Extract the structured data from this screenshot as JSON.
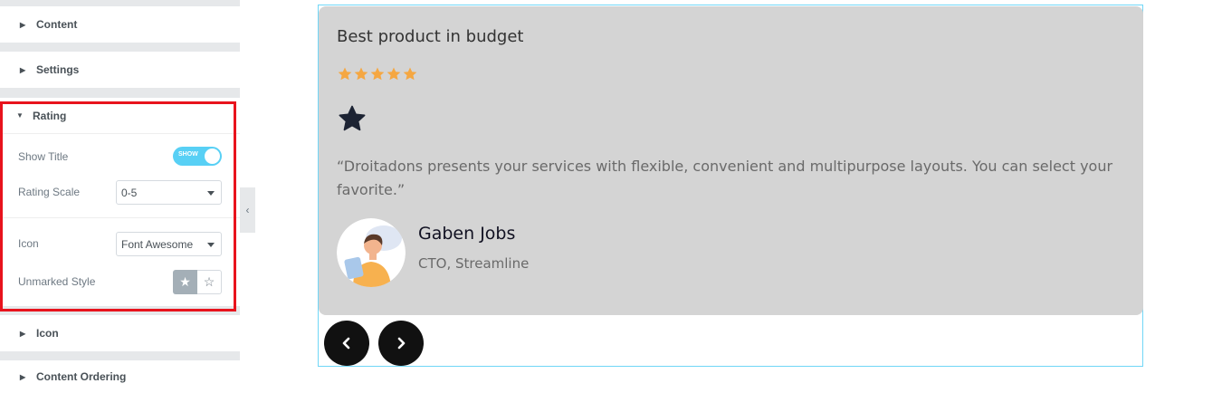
{
  "panel": {
    "sections": {
      "content": "Content",
      "settings": "Settings",
      "rating": "Rating",
      "icon": "Icon",
      "content_ordering": "Content Ordering"
    },
    "rating_controls": {
      "show_title_label": "Show Title",
      "show_title_toggle_text": "SHOW",
      "show_title_value": true,
      "rating_scale_label": "Rating Scale",
      "rating_scale_value": "0-5",
      "icon_label": "Icon",
      "icon_value": "Font Awesome",
      "unmarked_style_label": "Unmarked Style",
      "unmarked_style_selected": "solid-star"
    },
    "highlight_color": "#e8131d"
  },
  "preview": {
    "title": "Best product in budget",
    "rating": 5,
    "rating_max": 5,
    "star_color": "#f5a742",
    "icon_star_color": "#1c2333",
    "quote": "“Droitadons presents your services with flexible, convenient and multipurpose layouts. You can select your favorite.”",
    "author_name": "Gaben Jobs",
    "author_role": "CTO, Streamline",
    "card_bg": "#d4d4d4",
    "nav_prev_icon": "chevron-left-icon",
    "nav_next_icon": "chevron-right-icon"
  }
}
